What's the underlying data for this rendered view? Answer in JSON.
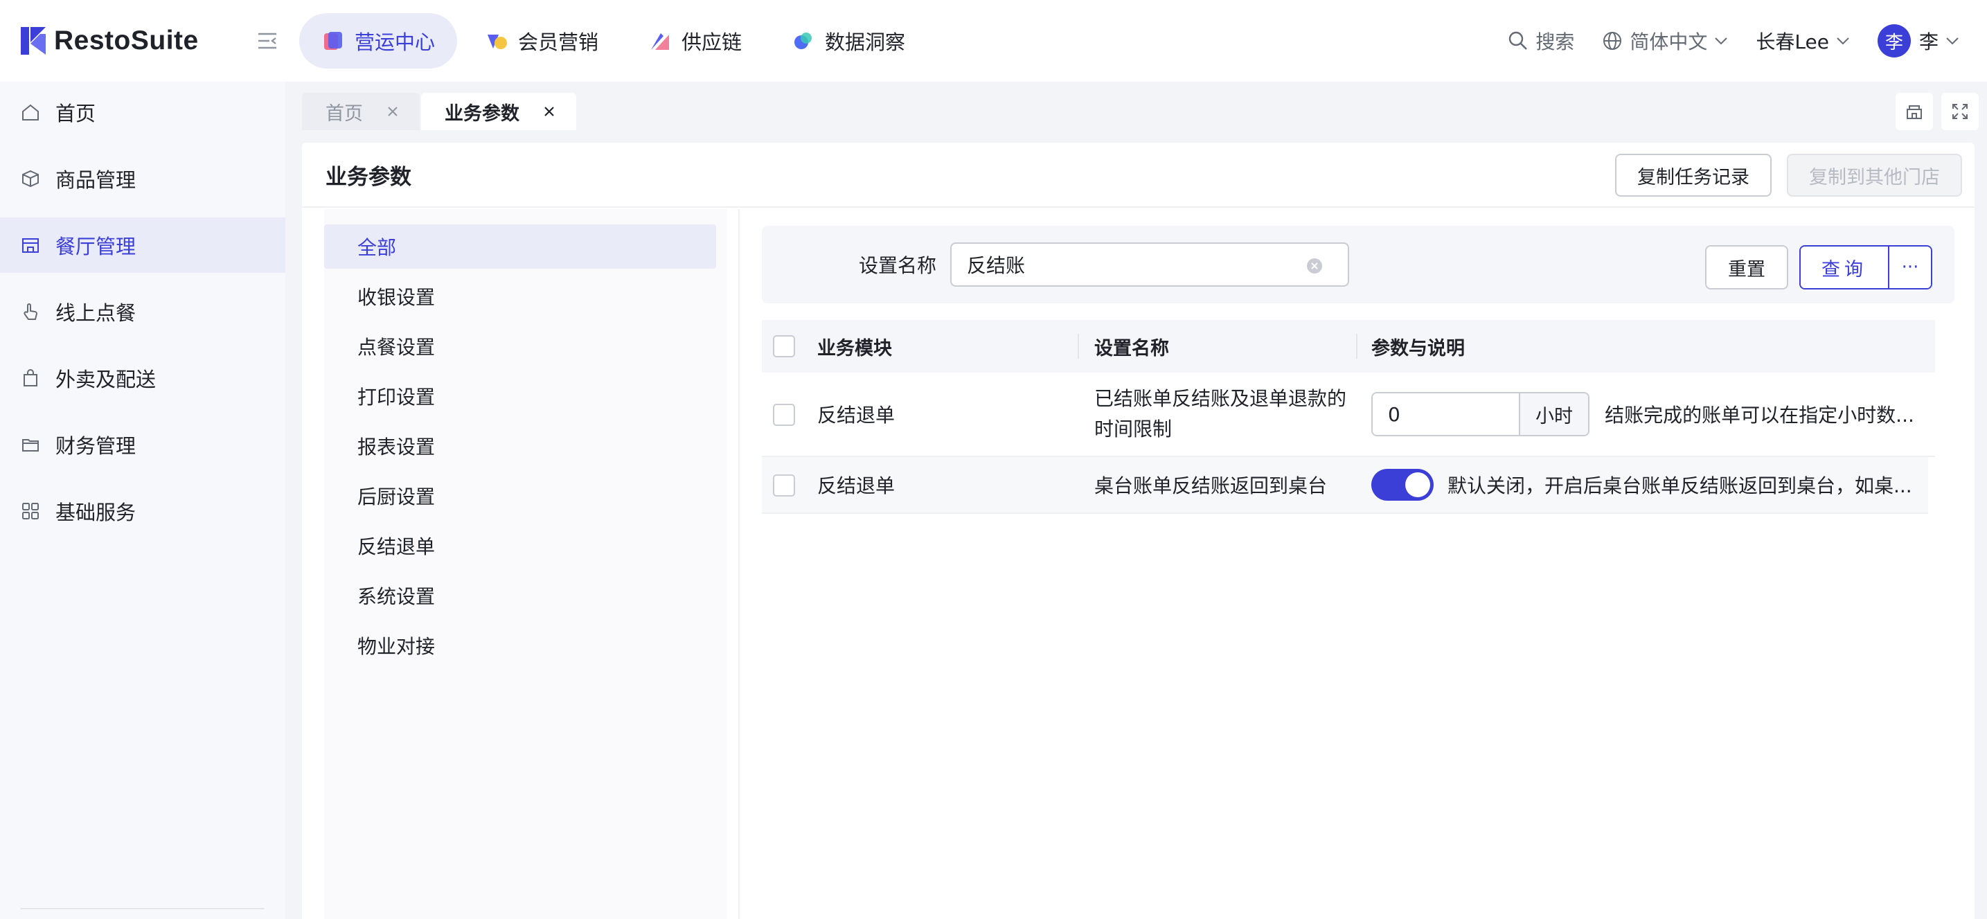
{
  "app": {
    "brand": "RestoSuite",
    "brand_color": "#3b3fd8"
  },
  "topnav": [
    {
      "label": "营运中心",
      "icon": "operations-icon",
      "active": true
    },
    {
      "label": "会员营销",
      "icon": "member-icon",
      "active": false
    },
    {
      "label": "供应链",
      "icon": "supply-chain-icon",
      "active": false
    },
    {
      "label": "数据洞察",
      "icon": "data-icon",
      "active": false
    }
  ],
  "header": {
    "search_label": "搜索",
    "language_label": "简体中文",
    "org_label": "长春Lee",
    "avatar_text": "李",
    "user_label": "李"
  },
  "sidebar": {
    "items": [
      {
        "label": "首页",
        "icon": "home-icon"
      },
      {
        "label": "商品管理",
        "icon": "box-icon"
      },
      {
        "label": "餐厅管理",
        "icon": "store-icon",
        "active": true
      },
      {
        "label": "线上点餐",
        "icon": "hand-tap-icon"
      },
      {
        "label": "外卖及配送",
        "icon": "bag-icon"
      },
      {
        "label": "财务管理",
        "icon": "folder-icon"
      },
      {
        "label": "基础服务",
        "icon": "grid-icon"
      }
    ]
  },
  "tabs": [
    {
      "label": "首页",
      "active": false
    },
    {
      "label": "业务参数",
      "active": true
    }
  ],
  "panel": {
    "title": "业务参数",
    "copy_records_label": "复制任务记录",
    "copy_to_stores_label": "复制到其他门店"
  },
  "categories": [
    "全部",
    "收银设置",
    "点餐设置",
    "打印设置",
    "报表设置",
    "后厨设置",
    "反结退单",
    "系统设置",
    "物业对接"
  ],
  "filter": {
    "label": "设置名称",
    "value": "反结账",
    "reset_label": "重置",
    "query_label": "查询",
    "more_label": "···"
  },
  "table": {
    "headers": [
      "业务模块",
      "设置名称",
      "参数与说明"
    ],
    "rows": [
      {
        "module": "反结退单",
        "name": "已结账单反结账及退单退款的时间限制",
        "value": "0",
        "unit": "小时",
        "desc": "结账完成的账单可以在指定小时数..."
      },
      {
        "module": "反结退单",
        "name": "桌台账单反结账返回到桌台",
        "toggle_on": true,
        "desc": "默认关闭，开启后桌台账单反结账返回到桌台，如桌..."
      }
    ]
  }
}
